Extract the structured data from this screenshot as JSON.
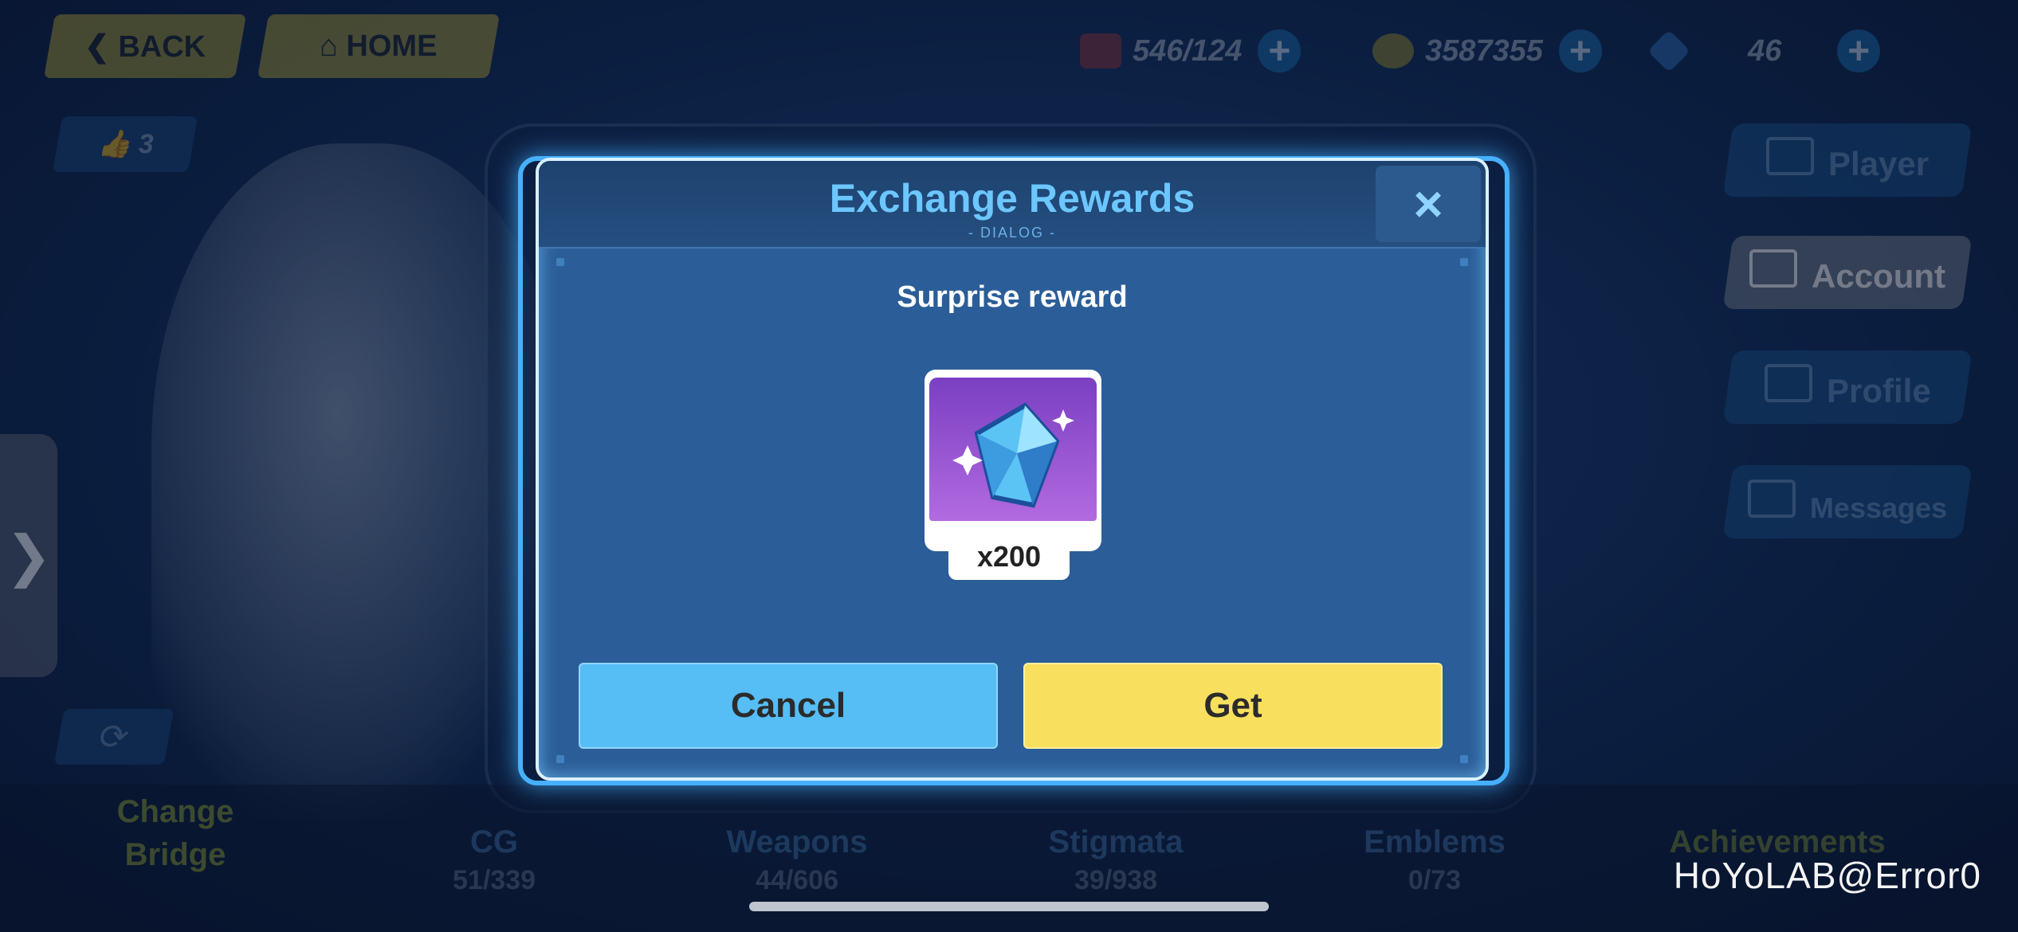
{
  "topbar": {
    "back_label": "BACK",
    "home_label": "HOME",
    "resources": [
      {
        "icon": "stamina-icon",
        "value": "546/124"
      },
      {
        "icon": "coin-icon",
        "value": "3587355"
      },
      {
        "icon": "crystal-icon",
        "value": "46"
      }
    ]
  },
  "left": {
    "likes_count": "3",
    "side_arrow": "❯"
  },
  "menu": {
    "items": [
      {
        "label": "Player",
        "icon": "id-card-icon",
        "active": false
      },
      {
        "label": "Account",
        "icon": "lock-icon",
        "active": true
      },
      {
        "label": "Profile",
        "icon": "profile-card-icon",
        "active": false
      },
      {
        "label": "Messages",
        "icon": "list-icon",
        "active": false
      }
    ]
  },
  "bottom": {
    "change_bridge": "Change Bridge",
    "items": [
      {
        "label": "CG",
        "count": "51/339"
      },
      {
        "label": "Weapons",
        "count": "44/606"
      },
      {
        "label": "Stigmata",
        "count": "39/938"
      },
      {
        "label": "Emblems",
        "count": "0/73"
      },
      {
        "label": "Achievements",
        "count": ""
      }
    ]
  },
  "background_title": "Account",
  "dialog": {
    "title": "Exchange Rewards",
    "subtitle": "- DIALOG -",
    "close_icon": "×",
    "message": "Surprise reward",
    "reward": {
      "icon": "crystal-icon",
      "quantity": "x200"
    },
    "cancel_label": "Cancel",
    "get_label": "Get"
  },
  "watermark": "HoYoLAB@Error0",
  "colors": {
    "accent_blue": "#56bdf5",
    "accent_yellow": "#f8df5d",
    "title_blue": "#6cc6ff"
  }
}
